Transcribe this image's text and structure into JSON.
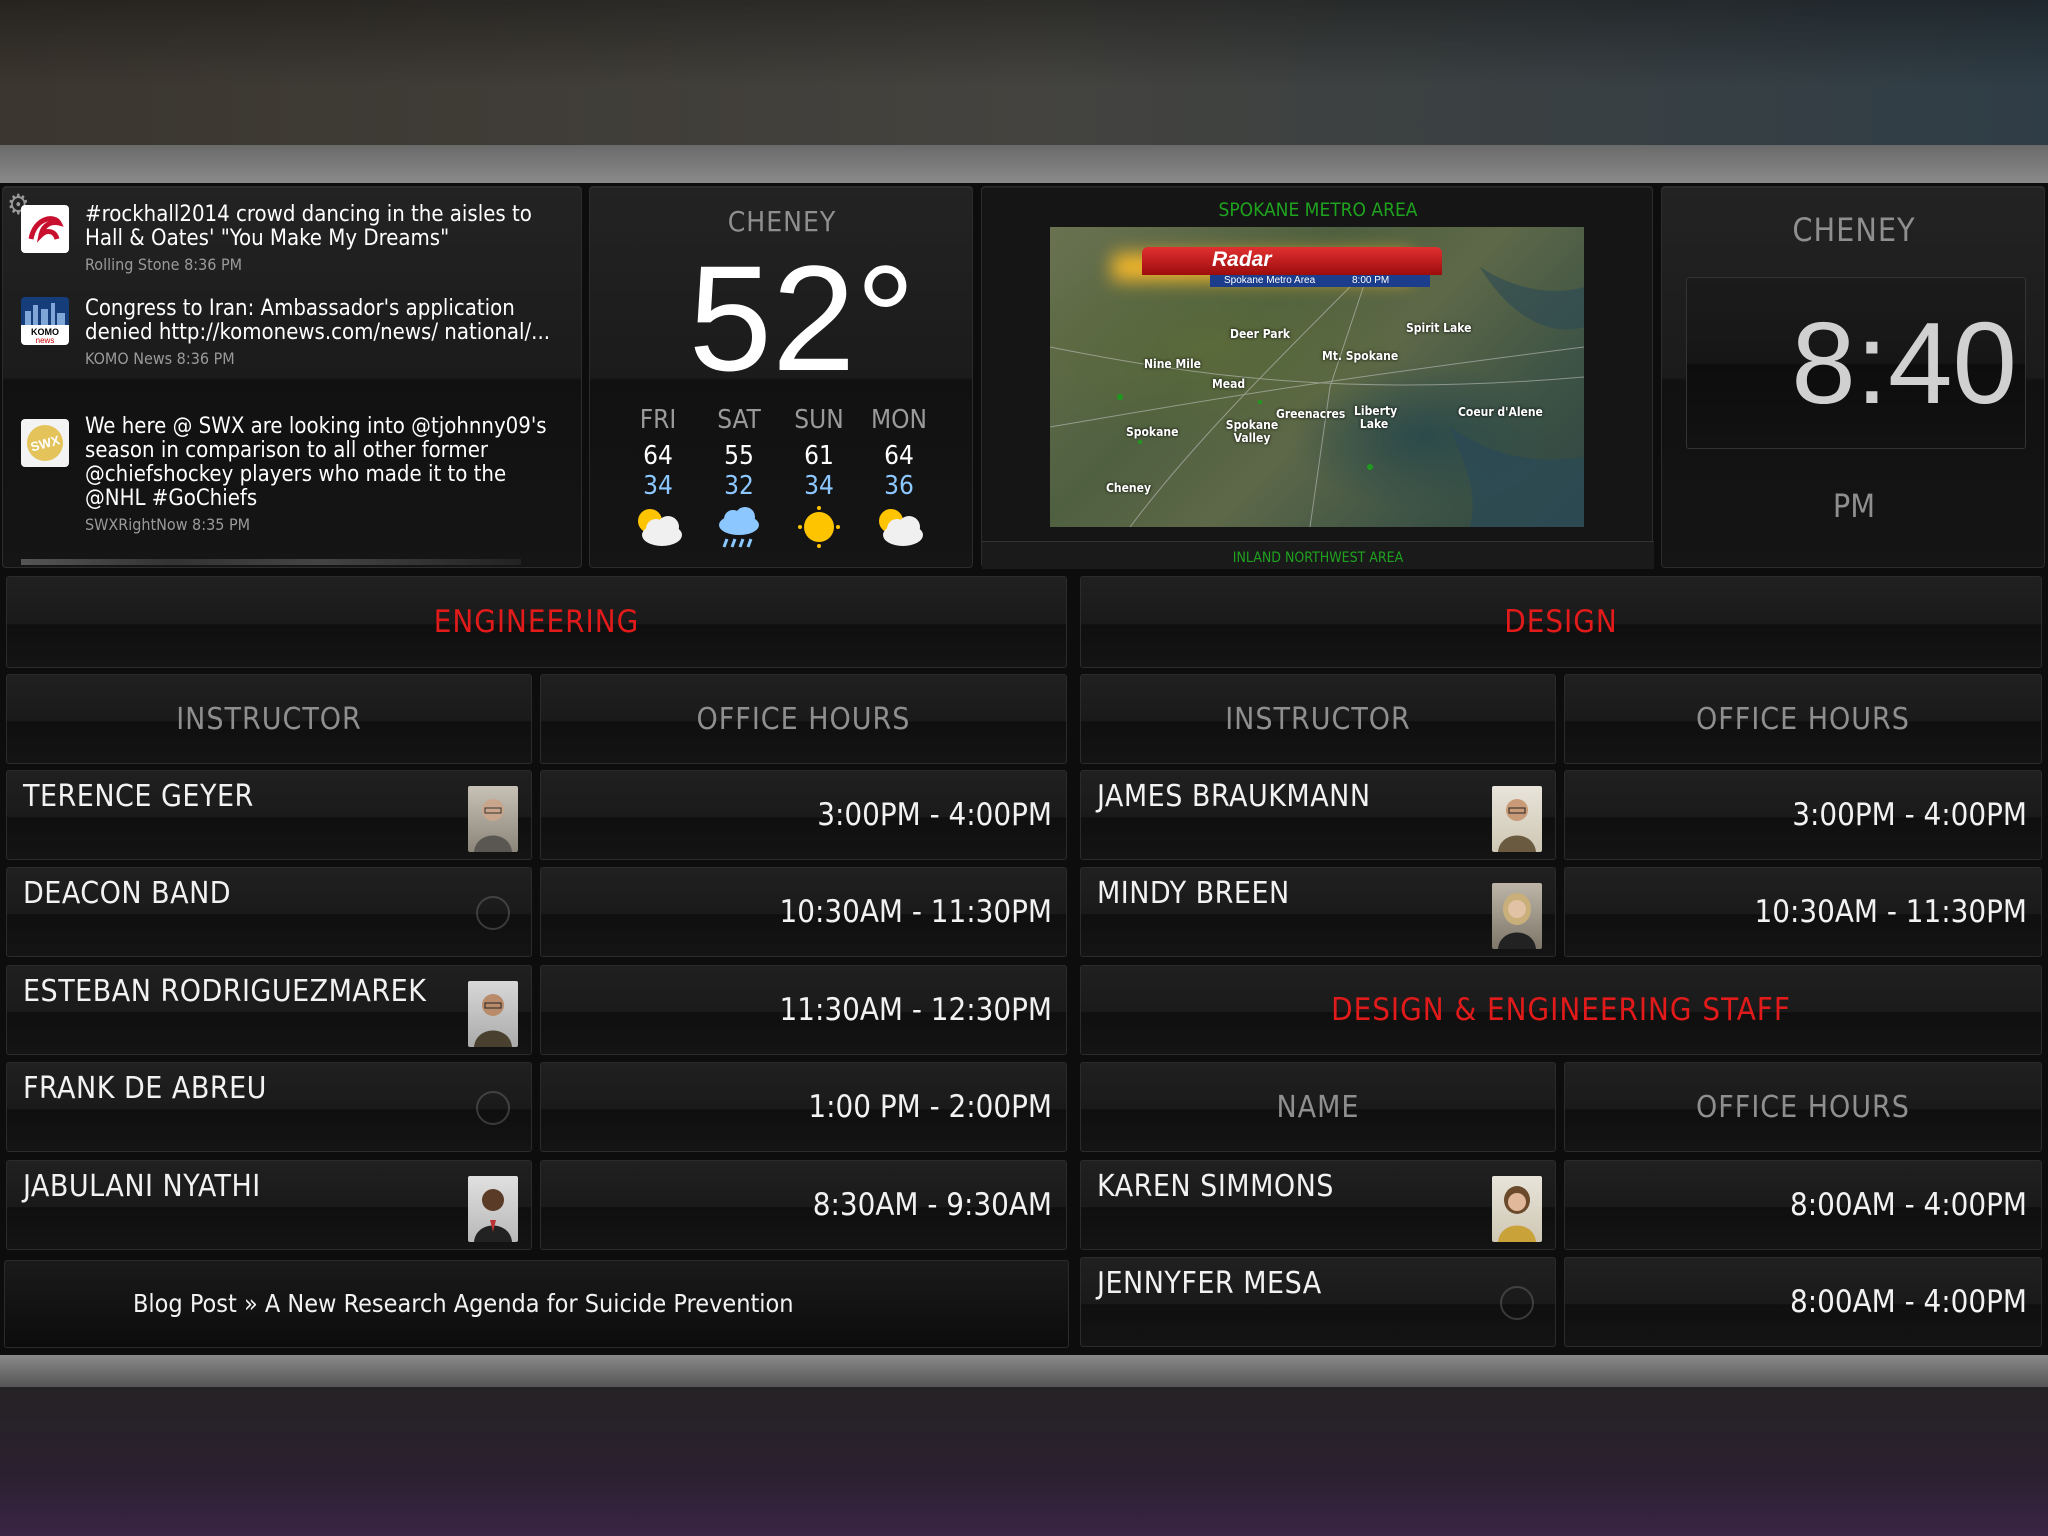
{
  "feed": {
    "items": [
      {
        "text": "#rockhall2014 crowd dancing in the aisles to Hall & Oates' \"You Make My Dreams\"",
        "source": "Rolling Stone 8:36 PM",
        "logo": "rolling-stone-logo"
      },
      {
        "text": "Congress to Iran: Ambassador's application denied http://komonews.com/news/ national/...",
        "source": "KOMO News 8:36 PM",
        "logo": "komo-news-logo"
      },
      {
        "text": "We here @ SWX are looking into @tjohnny09's season in comparison to all other former @chiefshockey players who made it to the @NHL #GoChiefs",
        "source": "SWXRightNow 8:35 PM",
        "logo": "swx-logo"
      }
    ],
    "settings_icon": "gear-icon"
  },
  "weather": {
    "city": "CHENEY",
    "temp": "52°",
    "forecast": [
      {
        "day": "FRI",
        "high": "64",
        "low": "34",
        "icon": "partly-cloudy-icon"
      },
      {
        "day": "SAT",
        "high": "55",
        "low": "32",
        "icon": "rain-icon"
      },
      {
        "day": "SUN",
        "high": "61",
        "low": "34",
        "icon": "sun-icon"
      },
      {
        "day": "MON",
        "high": "64",
        "low": "36",
        "icon": "partly-cloudy-icon"
      }
    ]
  },
  "radar": {
    "title": "SPOKANE METRO AREA",
    "banner": "Radar",
    "banner_sub": "Spokane Metro Area",
    "banner_time": "8:00 PM",
    "footer": "INLAND NORTHWEST AREA",
    "places": [
      "Deer Park",
      "Spirit Lake",
      "Mt. Spokane",
      "Nine Mile",
      "Mead",
      "Greenacres",
      "Liberty Lake",
      "Coeur d'Alene",
      "Spokane",
      "Spokane Valley",
      "Cheney"
    ]
  },
  "clock": {
    "city": "CHENEY",
    "time": "8:40",
    "ampm": "PM"
  },
  "engineering": {
    "title": "ENGINEERING",
    "col_instructor": "INSTRUCTOR",
    "col_hours": "OFFICE HOURS",
    "rows": [
      {
        "name": "TERENCE GEYER",
        "hours": "3:00PM - 4:00PM",
        "photo": true
      },
      {
        "name": "DEACON BAND",
        "hours": "10:30AM - 11:30PM",
        "photo": false
      },
      {
        "name": "ESTEBAN RODRIGUEZMAREK",
        "hours": "11:30AM - 12:30PM",
        "photo": true
      },
      {
        "name": "FRANK DE ABREU",
        "hours": "1:00 PM - 2:00PM",
        "photo": false
      },
      {
        "name": "JABULANI NYATHI",
        "hours": "8:30AM - 9:30AM",
        "photo": true
      }
    ]
  },
  "design": {
    "title": "DESIGN",
    "col_instructor": "INSTRUCTOR",
    "col_hours": "OFFICE HOURS",
    "rows": [
      {
        "name": "JAMES BRAUKMANN",
        "hours": "3:00PM - 4:00PM",
        "photo": true
      },
      {
        "name": "MINDY BREEN",
        "hours": "10:30AM - 11:30PM",
        "photo": true
      }
    ]
  },
  "staff": {
    "title": "DESIGN & ENGINEERING STAFF",
    "col_name": "NAME",
    "col_hours": "OFFICE HOURS",
    "rows": [
      {
        "name": "KAREN SIMMONS",
        "hours": "8:00AM - 4:00PM",
        "photo": true
      },
      {
        "name": "JENNYFER MESA",
        "hours": "8:00AM - 4:00PM",
        "photo": false
      }
    ]
  },
  "ticker": {
    "text": "Blog Post » A New Research Agenda for Suicide Prevention"
  },
  "colors": {
    "section_red": "#e21a1a",
    "low_temp_blue": "#8cc8ff",
    "radar_green": "#1fa31f"
  }
}
